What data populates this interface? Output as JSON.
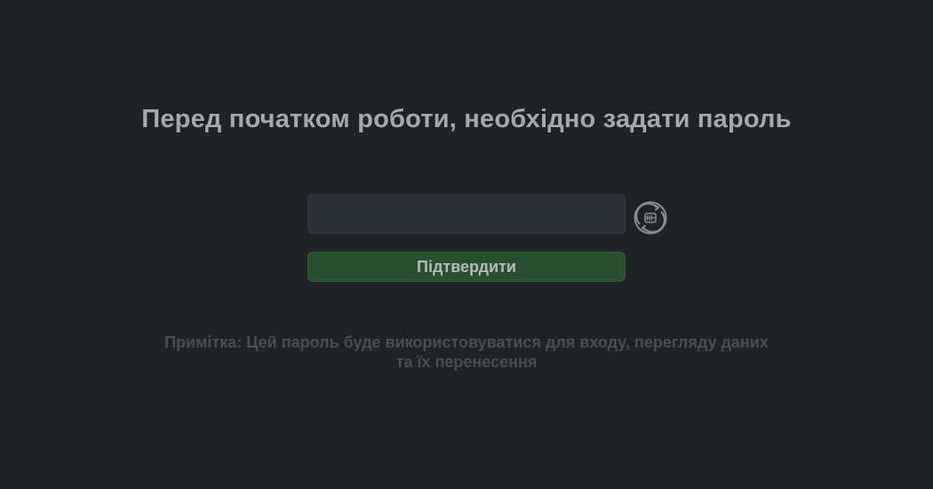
{
  "setup": {
    "title": "Перед початком роботи, необхідно задати пароль",
    "password": {
      "value": "",
      "placeholder": ""
    },
    "generate_icon": "password-generate-icon",
    "confirm_label": "Підтвердити",
    "note_line1": "Примітка: Цей пароль буде використовуватися для входу, перегляду даних",
    "note_line2": "та їх перенесення"
  },
  "colors": {
    "background": "#202226",
    "title": "#a6a8ac",
    "input_bg": "#2c3038",
    "button_bg": "#2a4f2e",
    "note": "#4a4d53"
  }
}
